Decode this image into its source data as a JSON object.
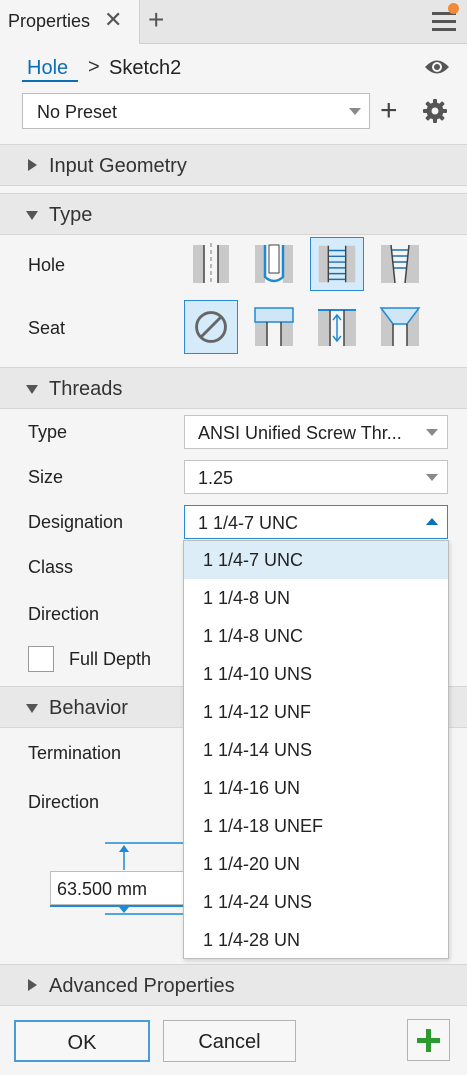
{
  "panel": {
    "tab_title": "Properties",
    "close_icon": "close-icon",
    "add_tab_icon": "plus-icon",
    "menu_icon": "hamburger-icon"
  },
  "breadcrumb": {
    "feature": "Hole",
    "separator": ">",
    "sketch": "Sketch2"
  },
  "preset": {
    "value": "No Preset"
  },
  "sections": {
    "input_geometry": "Input Geometry",
    "type": "Type",
    "threads": "Threads",
    "behavior": "Behavior",
    "advanced": "Advanced Properties"
  },
  "type_section": {
    "hole_label": "Hole",
    "seat_label": "Seat",
    "hole_options": [
      "simple-hole-icon",
      "clearance-hole-icon",
      "tapped-hole-icon",
      "taper-tapped-hole-icon"
    ],
    "hole_selected_index": 2,
    "seat_options": [
      "none-seat-icon",
      "counterbore-icon",
      "spotface-icon",
      "countersink-icon"
    ],
    "seat_selected_index": 0
  },
  "threads_section": {
    "type_label": "Type",
    "type_value": "ANSI Unified Screw Thr...",
    "size_label": "Size",
    "size_value": "1.25",
    "designation_label": "Designation",
    "designation_value": "1 1/4-7 UNC",
    "class_label": "Class",
    "direction_label": "Direction",
    "full_depth_label": "Full Depth",
    "full_depth_checked": false
  },
  "behavior_section": {
    "termination_label": "Termination",
    "direction_label": "Direction",
    "depth_value": "63.500 mm"
  },
  "designation_dropdown": {
    "selected_index": 0,
    "options": [
      "1 1/4-7 UNC",
      "1 1/4-8 UN",
      "1 1/4-8 UNC",
      "1 1/4-10 UNS",
      "1 1/4-12 UNF",
      "1 1/4-14 UNS",
      "1 1/4-16 UN",
      "1 1/4-18 UNEF",
      "1 1/4-20 UN",
      "1 1/4-24 UNS",
      "1 1/4-28 UN"
    ]
  },
  "footer": {
    "ok_label": "OK",
    "cancel_label": "Cancel",
    "apply_icon": "green-plus-icon"
  },
  "colors": {
    "accent": "#0b6fb8",
    "selection": "#dcedf7",
    "notify": "#f08a3a",
    "apply": "#2b9b2f"
  }
}
